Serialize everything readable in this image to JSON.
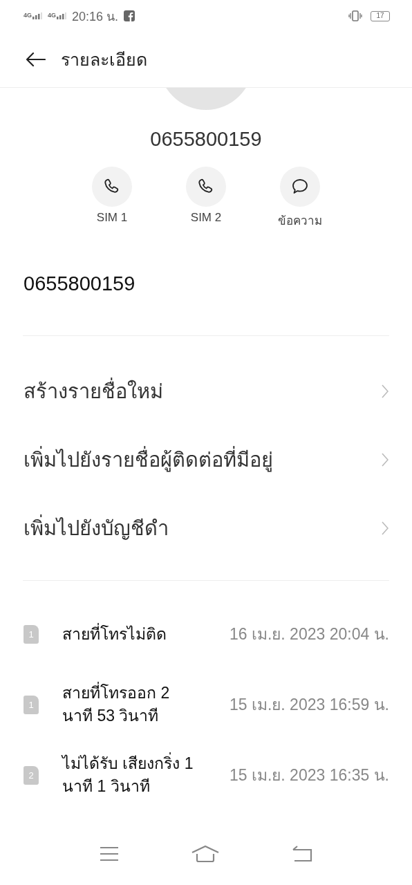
{
  "status_bar": {
    "signals": [
      "4G",
      "4G"
    ],
    "time": "20:16 น.",
    "battery": "17"
  },
  "header": {
    "title": "รายละเอียด"
  },
  "contact": {
    "number": "0655800159",
    "kind": "picture"
  },
  "actions": [
    {
      "kind": "call",
      "label": "SIM 1"
    },
    {
      "kind": "call",
      "label": "SIM 2"
    },
    {
      "kind": "message",
      "label": "ข้อความ"
    }
  ],
  "number_line": "0655800159",
  "menu": [
    "สร้างรายชื่อใหม่",
    "เพิ่มไปยังรายชื่อผู้ติดต่อที่มีอยู่",
    "เพิ่มไปยังบัญชีดำ"
  ],
  "call_log": [
    {
      "sim": "1",
      "text": "สายที่โทรไม่ติด",
      "time": "16 เม.ย. 2023 20:04 น."
    },
    {
      "sim": "1",
      "text": "สายที่โทรออก 2 นาที 53 วินาที",
      "time": "15 เม.ย. 2023 16:59 น."
    },
    {
      "sim": "2",
      "text": "ไม่ได้รับ เสียงกริ่ง 1 นาที 1 วินาที",
      "time": "15 เม.ย. 2023 16:35 น."
    }
  ]
}
